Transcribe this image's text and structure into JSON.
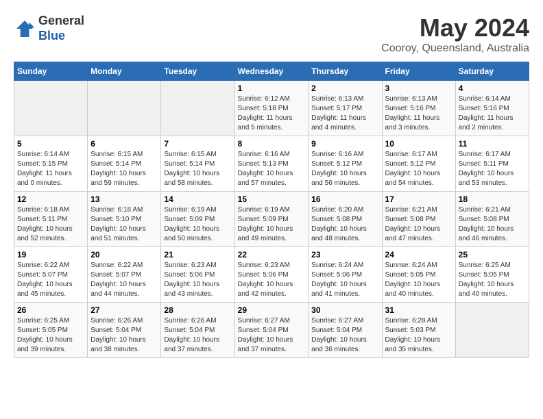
{
  "header": {
    "logo_general": "General",
    "logo_blue": "Blue",
    "month": "May 2024",
    "location": "Cooroy, Queensland, Australia"
  },
  "days_of_week": [
    "Sunday",
    "Monday",
    "Tuesday",
    "Wednesday",
    "Thursday",
    "Friday",
    "Saturday"
  ],
  "weeks": [
    [
      {
        "day": "",
        "empty": true
      },
      {
        "day": "",
        "empty": true
      },
      {
        "day": "",
        "empty": true
      },
      {
        "day": "1",
        "sunrise": "6:12 AM",
        "sunset": "5:18 PM",
        "daylight": "11 hours and 5 minutes."
      },
      {
        "day": "2",
        "sunrise": "6:13 AM",
        "sunset": "5:17 PM",
        "daylight": "11 hours and 4 minutes."
      },
      {
        "day": "3",
        "sunrise": "6:13 AM",
        "sunset": "5:16 PM",
        "daylight": "11 hours and 3 minutes."
      },
      {
        "day": "4",
        "sunrise": "6:14 AM",
        "sunset": "5:16 PM",
        "daylight": "11 hours and 2 minutes."
      }
    ],
    [
      {
        "day": "5",
        "sunrise": "6:14 AM",
        "sunset": "5:15 PM",
        "daylight": "11 hours and 0 minutes."
      },
      {
        "day": "6",
        "sunrise": "6:15 AM",
        "sunset": "5:14 PM",
        "daylight": "10 hours and 59 minutes."
      },
      {
        "day": "7",
        "sunrise": "6:15 AM",
        "sunset": "5:14 PM",
        "daylight": "10 hours and 58 minutes."
      },
      {
        "day": "8",
        "sunrise": "6:16 AM",
        "sunset": "5:13 PM",
        "daylight": "10 hours and 57 minutes."
      },
      {
        "day": "9",
        "sunrise": "6:16 AM",
        "sunset": "5:12 PM",
        "daylight": "10 hours and 56 minutes."
      },
      {
        "day": "10",
        "sunrise": "6:17 AM",
        "sunset": "5:12 PM",
        "daylight": "10 hours and 54 minutes."
      },
      {
        "day": "11",
        "sunrise": "6:17 AM",
        "sunset": "5:11 PM",
        "daylight": "10 hours and 53 minutes."
      }
    ],
    [
      {
        "day": "12",
        "sunrise": "6:18 AM",
        "sunset": "5:11 PM",
        "daylight": "10 hours and 52 minutes."
      },
      {
        "day": "13",
        "sunrise": "6:18 AM",
        "sunset": "5:10 PM",
        "daylight": "10 hours and 51 minutes."
      },
      {
        "day": "14",
        "sunrise": "6:19 AM",
        "sunset": "5:09 PM",
        "daylight": "10 hours and 50 minutes."
      },
      {
        "day": "15",
        "sunrise": "6:19 AM",
        "sunset": "5:09 PM",
        "daylight": "10 hours and 49 minutes."
      },
      {
        "day": "16",
        "sunrise": "6:20 AM",
        "sunset": "5:08 PM",
        "daylight": "10 hours and 48 minutes."
      },
      {
        "day": "17",
        "sunrise": "6:21 AM",
        "sunset": "5:08 PM",
        "daylight": "10 hours and 47 minutes."
      },
      {
        "day": "18",
        "sunrise": "6:21 AM",
        "sunset": "5:08 PM",
        "daylight": "10 hours and 46 minutes."
      }
    ],
    [
      {
        "day": "19",
        "sunrise": "6:22 AM",
        "sunset": "5:07 PM",
        "daylight": "10 hours and 45 minutes."
      },
      {
        "day": "20",
        "sunrise": "6:22 AM",
        "sunset": "5:07 PM",
        "daylight": "10 hours and 44 minutes."
      },
      {
        "day": "21",
        "sunrise": "6:23 AM",
        "sunset": "5:06 PM",
        "daylight": "10 hours and 43 minutes."
      },
      {
        "day": "22",
        "sunrise": "6:23 AM",
        "sunset": "5:06 PM",
        "daylight": "10 hours and 42 minutes."
      },
      {
        "day": "23",
        "sunrise": "6:24 AM",
        "sunset": "5:06 PM",
        "daylight": "10 hours and 41 minutes."
      },
      {
        "day": "24",
        "sunrise": "6:24 AM",
        "sunset": "5:05 PM",
        "daylight": "10 hours and 40 minutes."
      },
      {
        "day": "25",
        "sunrise": "6:25 AM",
        "sunset": "5:05 PM",
        "daylight": "10 hours and 40 minutes."
      }
    ],
    [
      {
        "day": "26",
        "sunrise": "6:25 AM",
        "sunset": "5:05 PM",
        "daylight": "10 hours and 39 minutes."
      },
      {
        "day": "27",
        "sunrise": "6:26 AM",
        "sunset": "5:04 PM",
        "daylight": "10 hours and 38 minutes."
      },
      {
        "day": "28",
        "sunrise": "6:26 AM",
        "sunset": "5:04 PM",
        "daylight": "10 hours and 37 minutes."
      },
      {
        "day": "29",
        "sunrise": "6:27 AM",
        "sunset": "5:04 PM",
        "daylight": "10 hours and 37 minutes."
      },
      {
        "day": "30",
        "sunrise": "6:27 AM",
        "sunset": "5:04 PM",
        "daylight": "10 hours and 36 minutes."
      },
      {
        "day": "31",
        "sunrise": "6:28 AM",
        "sunset": "5:03 PM",
        "daylight": "10 hours and 35 minutes."
      },
      {
        "day": "",
        "empty": true
      }
    ]
  ],
  "labels": {
    "sunrise_prefix": "Sunrise: ",
    "sunset_prefix": "Sunset: ",
    "daylight_prefix": "Daylight: "
  }
}
